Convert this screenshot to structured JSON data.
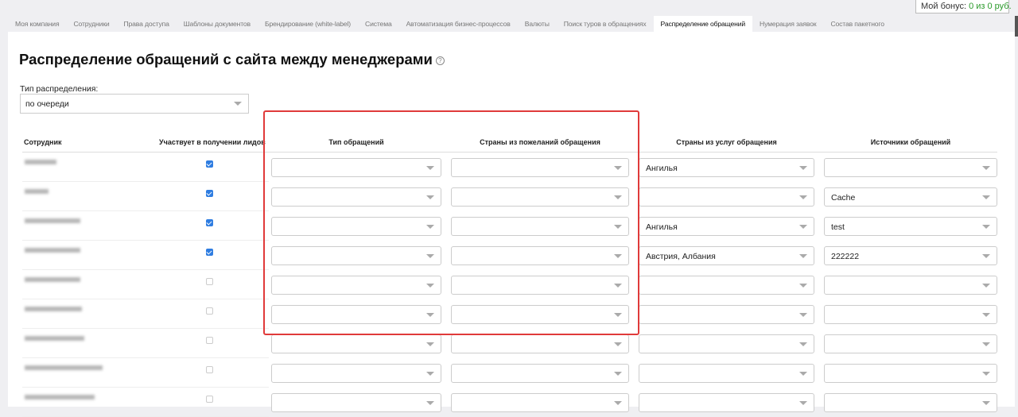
{
  "bonus": {
    "label": "Мой бонус:",
    "value": "0 из 0 руб."
  },
  "tabs": [
    "Моя компания",
    "Сотрудники",
    "Права доступа",
    "Шаблоны документов",
    "Брендирование (white-label)",
    "Система",
    "Автоматизация бизнес-процессов",
    "Валюты",
    "Поиск туров в обращениях",
    "Распределение обращений",
    "Нумерация заявок",
    "Состав пакетного"
  ],
  "active_tab": 9,
  "title": "Распределение обращений с сайта между менеджерами",
  "help_icon": "?",
  "distribution": {
    "label": "Тип распределения:",
    "value": "по очереди"
  },
  "columns": [
    "Сотрудник",
    "Участвует в получении лидов",
    "Тип обращений",
    "Страны из пожеланий обращения",
    "Страны из услуг обращения",
    "Источники обращений"
  ],
  "rows": [
    {
      "checked": true,
      "type": "",
      "wish": "",
      "service": "Ангилья",
      "source": ""
    },
    {
      "checked": true,
      "type": "",
      "wish": "",
      "service": "",
      "source": "Cache"
    },
    {
      "checked": true,
      "type": "",
      "wish": "",
      "service": "Ангилья",
      "source": "test"
    },
    {
      "checked": true,
      "type": "",
      "wish": "",
      "service": "Австрия, Албания",
      "source": "222222"
    },
    {
      "checked": false,
      "type": "",
      "wish": "",
      "service": "",
      "source": ""
    },
    {
      "checked": false,
      "type": "",
      "wish": "",
      "service": "",
      "source": ""
    },
    {
      "checked": false,
      "type": "",
      "wish": "",
      "service": "",
      "source": ""
    },
    {
      "checked": false,
      "type": "",
      "wish": "",
      "service": "",
      "source": ""
    },
    {
      "checked": false,
      "type": "",
      "wish": "",
      "service": "",
      "source": ""
    }
  ],
  "colors": {
    "accent": "#2f7de1",
    "highlight": "#e03a3a",
    "bonus": "#2a9a2a"
  }
}
